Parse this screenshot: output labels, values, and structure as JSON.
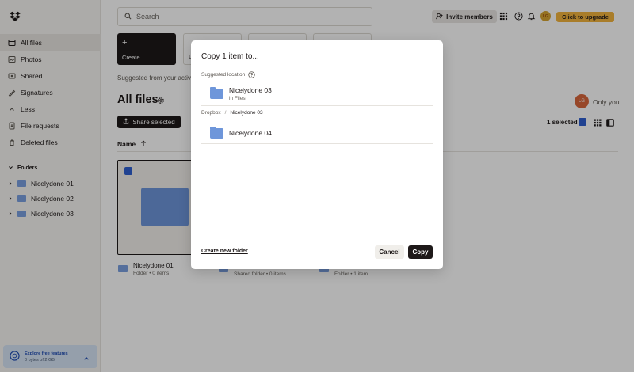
{
  "sidebar": {
    "items": [
      {
        "label": "All files",
        "icon": "all-files-icon"
      },
      {
        "label": "Photos",
        "icon": "photos-icon"
      },
      {
        "label": "Shared",
        "icon": "shared-icon"
      },
      {
        "label": "Signatures",
        "icon": "signatures-icon"
      },
      {
        "label": "Less",
        "icon": "chevron-up-icon"
      },
      {
        "label": "File requests",
        "icon": "file-requests-icon"
      },
      {
        "label": "Deleted files",
        "icon": "trash-icon"
      }
    ],
    "folders_heading": "Folders",
    "folders": [
      "Nicelydone 01",
      "Nicelydone 02",
      "Nicelydone 03"
    ],
    "promo_title": "Explore free features",
    "promo_sub": "0 bytes of 2 GB"
  },
  "header": {
    "search_placeholder": "Search",
    "invite_label": "Invite members",
    "avatar_initials": "LG",
    "upgrade_label": "Click to upgrade"
  },
  "main": {
    "create_label": "Create",
    "tile2_label": "U",
    "suggested_text": "Suggested from your activ",
    "title": "All files",
    "share_selected": "Share selected",
    "owner_initials": "LG",
    "owner_text": "Only you",
    "selected_count": "1 selected",
    "name_column": "Name",
    "cards": [
      {
        "name": "Nicelydone 01",
        "meta": "Folder • 0 items"
      },
      {
        "name": "",
        "meta": "Shared folder • 0 items"
      },
      {
        "name": "",
        "meta": "Folder • 1 item"
      }
    ]
  },
  "modal": {
    "title": "Copy 1 item to...",
    "suggested_label": "Suggested location",
    "suggested_folder": {
      "name": "Nicelydone 03",
      "sub": "in Files"
    },
    "breadcrumb_root": "Dropbox",
    "breadcrumb_sep": "/",
    "breadcrumb_current": "Nicelydone 03",
    "folders": [
      "Nicelydone 04"
    ],
    "create_folder": "Create new folder",
    "cancel": "Cancel",
    "copy": "Copy"
  },
  "colors": {
    "accent_blue": "#2f5fd0",
    "folder_blue": "#6e96da",
    "upgrade_yellow": "#f2b33d",
    "dark": "#1e1919"
  }
}
